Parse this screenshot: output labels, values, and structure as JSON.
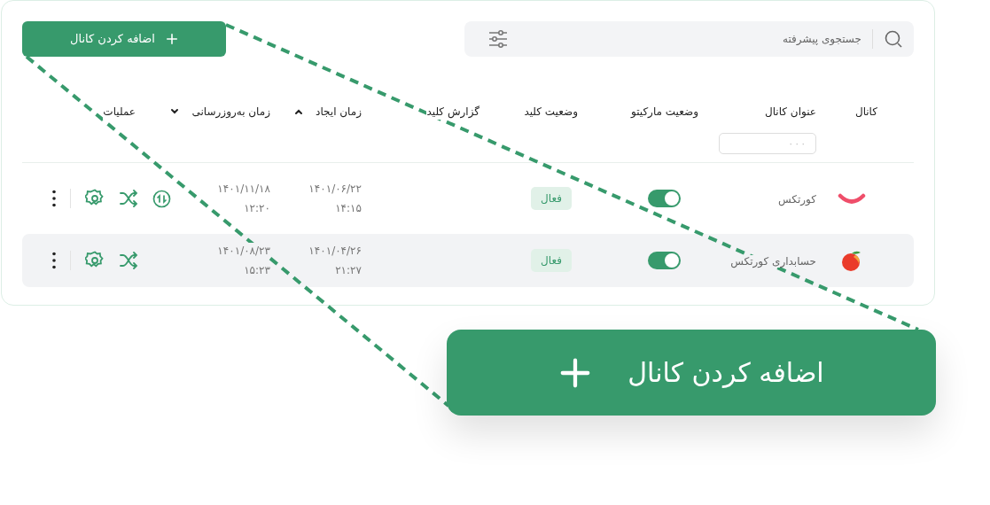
{
  "add_button": {
    "label": "اضافه کردن کانال"
  },
  "search": {
    "placeholder": "جستجوی پیشرفته"
  },
  "table": {
    "columns": [
      {
        "label": "کانال",
        "kind": "plain"
      },
      {
        "label": "عنوان کانال",
        "kind": "filter",
        "filter_placeholder": "· · ·"
      },
      {
        "label": "وضعیت مارکیتو",
        "kind": "plain"
      },
      {
        "label": "وضعیت کلید",
        "kind": "plain"
      },
      {
        "label": "گزارش کلید",
        "kind": "plain"
      },
      {
        "label": "زمان ایجاد",
        "kind": "sort-up"
      },
      {
        "label": "زمان به‌روزرسانی",
        "kind": "sort-down"
      },
      {
        "label": "عملیات",
        "kind": "plain"
      }
    ],
    "rows": [
      {
        "kind": "arc",
        "name": "کورتکس",
        "on": true,
        "status": "فعال",
        "created_date": "۱۴۰۱/۰۶/۲۲",
        "created_time": "۱۴:۱۵",
        "updated_date": "۱۴۰۱/۱۱/۱۸",
        "updated_time": "۱۲:۲۰",
        "sync": true,
        "selected": false
      },
      {
        "kind": "peach",
        "name": "حسابداری کورتکس",
        "on": true,
        "status": "فعال",
        "created_date": "۱۴۰۱/۰۴/۲۶",
        "created_time": "۲۱:۲۷",
        "updated_date": "۱۴۰۱/۰۸/۲۳",
        "updated_time": "۱۵:۲۳",
        "sync": false,
        "selected": true
      }
    ]
  },
  "callout": {
    "label": "اضافه کردن کانال"
  }
}
